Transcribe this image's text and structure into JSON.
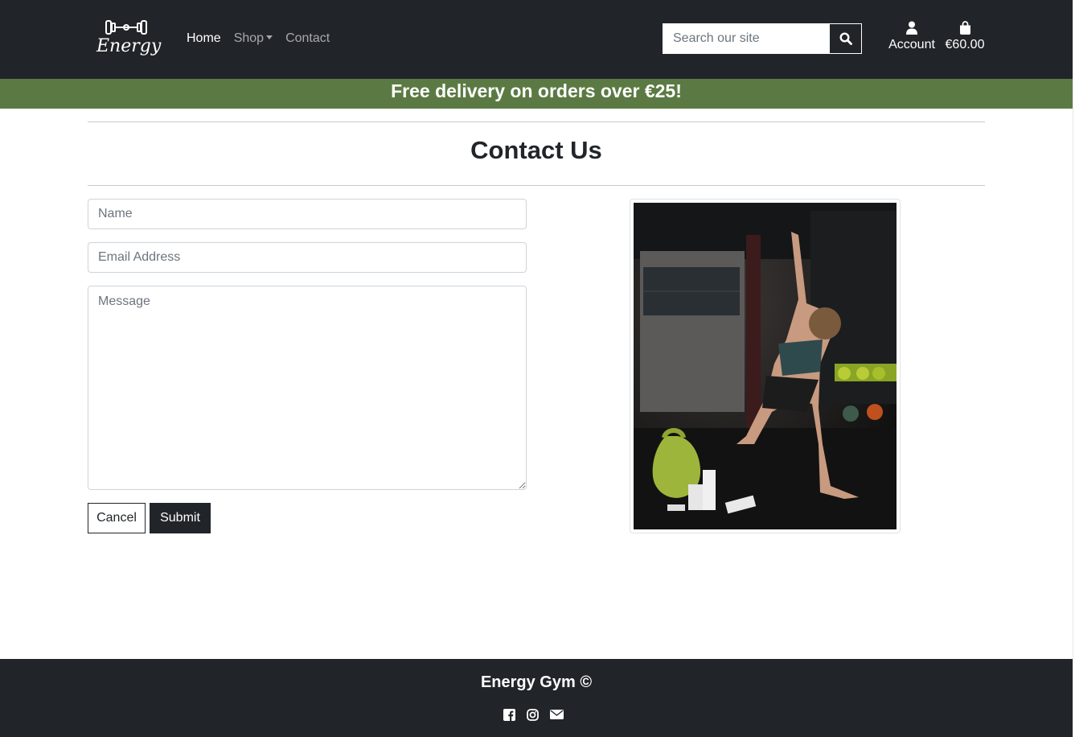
{
  "brand": {
    "logo_text": "Energy"
  },
  "nav": {
    "home": "Home",
    "shop": "Shop",
    "contact": "Contact"
  },
  "search": {
    "placeholder": "Search our site",
    "icon": "search-icon"
  },
  "account": {
    "label": "Account",
    "icon": "user-icon"
  },
  "bag": {
    "total": "€60.00",
    "icon": "shopping-bag-icon"
  },
  "banner": {
    "text": "Free delivery on orders over €25!"
  },
  "page": {
    "title": "Contact Us"
  },
  "form": {
    "name_placeholder": "Name",
    "email_placeholder": "Email Address",
    "message_placeholder": "Message",
    "cancel_label": "Cancel",
    "submit_label": "Submit"
  },
  "footer": {
    "title": "Energy Gym ©",
    "icons": [
      "facebook-icon",
      "instagram-icon",
      "envelope-icon"
    ]
  },
  "colors": {
    "dark": "#212529",
    "banner": "#5b7a43",
    "white": "#ffffff"
  }
}
